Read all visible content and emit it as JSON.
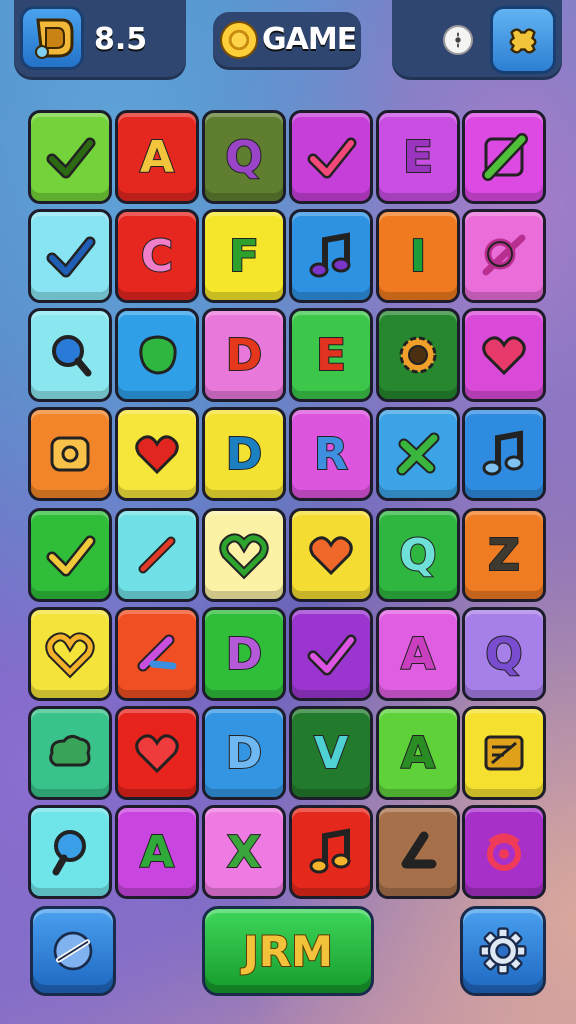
{
  "topbar": {
    "score": "8.5",
    "title": "GAME"
  },
  "board": {
    "rows": 8,
    "cols": 6,
    "tiles": [
      {
        "color": "#74d33a",
        "fg": "#2b6a12",
        "icon": "check-icon"
      },
      {
        "color": "#e4271f",
        "fg": "#f2c53d",
        "text": "A"
      },
      {
        "color": "#5f7e2f",
        "fg": "#9a45c8",
        "text": "Q"
      },
      {
        "color": "#c63fd8",
        "fg": "#f2487a",
        "icon": "check-icon"
      },
      {
        "color": "#c84fe2",
        "fg": "#9b35c0",
        "text": "E"
      },
      {
        "color": "#dc49e3",
        "fg": "#4fbf3a",
        "icon": "slash-icon"
      },
      {
        "color": "#88e4f2",
        "fg": "#1f5fb8",
        "icon": "check-icon"
      },
      {
        "color": "#e6271f",
        "fg": "#f07ec8",
        "text": "C"
      },
      {
        "color": "#f5e62b",
        "fg": "#2ea12d",
        "text": "F"
      },
      {
        "color": "#2e92e3",
        "fg": "#7b35c8",
        "icon": "music-note-icon"
      },
      {
        "color": "#f07a1f",
        "fg": "#1b9d3a",
        "text": "I"
      },
      {
        "color": "#ea6ed9",
        "fg": "#b82f8f",
        "icon": "knot-icon"
      },
      {
        "color": "#8ae7f0",
        "fg": "#2a7ad8",
        "icon": "search-icon"
      },
      {
        "color": "#2f9fe8",
        "fg": "#2fb640",
        "icon": "blob-icon"
      },
      {
        "color": "#e879db",
        "fg": "#e4371c",
        "text": "D"
      },
      {
        "color": "#3cc74b",
        "fg": "#e13320",
        "text": "E"
      },
      {
        "color": "#27872f",
        "fg": "#f0a02a",
        "icon": "gear-icon"
      },
      {
        "color": "#d94ad8",
        "fg": "#e53a6a",
        "icon": "heart-icon"
      },
      {
        "color": "#f2852a",
        "fg": "#f8c24a",
        "icon": "pretzel-icon"
      },
      {
        "color": "#f6e53a",
        "fg": "#e0261e",
        "icon": "heart-icon"
      },
      {
        "color": "#f4e232",
        "fg": "#1c7fbf",
        "text": "D"
      },
      {
        "color": "#dd54df",
        "fg": "#3f8fe0",
        "text": "R"
      },
      {
        "color": "#3ba3e6",
        "fg": "#3ab53e",
        "icon": "cross-arrows-icon"
      },
      {
        "color": "#2f8be0",
        "fg": "#7fc1f0",
        "icon": "music-note-icon"
      },
      {
        "color": "#2fbd3a",
        "fg": "#f2c93a",
        "icon": "check-icon"
      },
      {
        "color": "#6fe0e6",
        "fg": "#e33a2a",
        "icon": "pencil-icon"
      },
      {
        "color": "#fbf2a6",
        "fg": "#2ea32d",
        "icon": "heart-outline-icon"
      },
      {
        "color": "#f5dc33",
        "fg": "#f0672a",
        "icon": "heart-icon"
      },
      {
        "color": "#2fb640",
        "fg": "#6fe0d8",
        "text": "Q"
      },
      {
        "color": "#ef7b23",
        "fg": "#3e3a30",
        "text": "Z"
      },
      {
        "color": "#f4e33a",
        "fg": "#f4b22a",
        "icon": "heart-outline-icon"
      },
      {
        "color": "#ef4f22",
        "fg": "#c84fe0",
        "icon": "brush-icon"
      },
      {
        "color": "#2fbd3a",
        "fg": "#b45ad8",
        "text": "D"
      },
      {
        "color": "#9a36cf",
        "fg": "#dc55e3",
        "icon": "check-icon"
      },
      {
        "color": "#e05ee2",
        "fg": "#c93fbf",
        "text": "A"
      },
      {
        "color": "#a77fe8",
        "fg": "#7a4cd0",
        "text": "Q"
      },
      {
        "color": "#39c28a",
        "fg": "#3aa35a",
        "icon": "cloud-icon"
      },
      {
        "color": "#e6231c",
        "fg": "#ef3b3b",
        "icon": "heart-icon"
      },
      {
        "color": "#3496e2",
        "fg": "#6fb8f2",
        "text": "D"
      },
      {
        "color": "#227a2c",
        "fg": "#4fd1d4",
        "text": "V"
      },
      {
        "color": "#5fd23a",
        "fg": "#2a8d24",
        "text": "A"
      },
      {
        "color": "#f5e02f",
        "fg": "#e0a11a",
        "icon": "note-card-icon"
      },
      {
        "color": "#6fe5ea",
        "fg": "#3a9fe6",
        "icon": "magnifier-icon"
      },
      {
        "color": "#c845df",
        "fg": "#2faa3a",
        "text": "A"
      },
      {
        "color": "#ee7be2",
        "fg": "#3aa53a",
        "text": "X"
      },
      {
        "color": "#e4281c",
        "fg": "#f4b32a",
        "icon": "music-note-icon"
      },
      {
        "color": "#a6704a",
        "fg": "#3a3326",
        "icon": "angle-icon"
      },
      {
        "color": "#a730c9",
        "fg": "#ef3a5a",
        "icon": "target-icon"
      }
    ]
  },
  "bottom": {
    "main_label": "JRM"
  }
}
